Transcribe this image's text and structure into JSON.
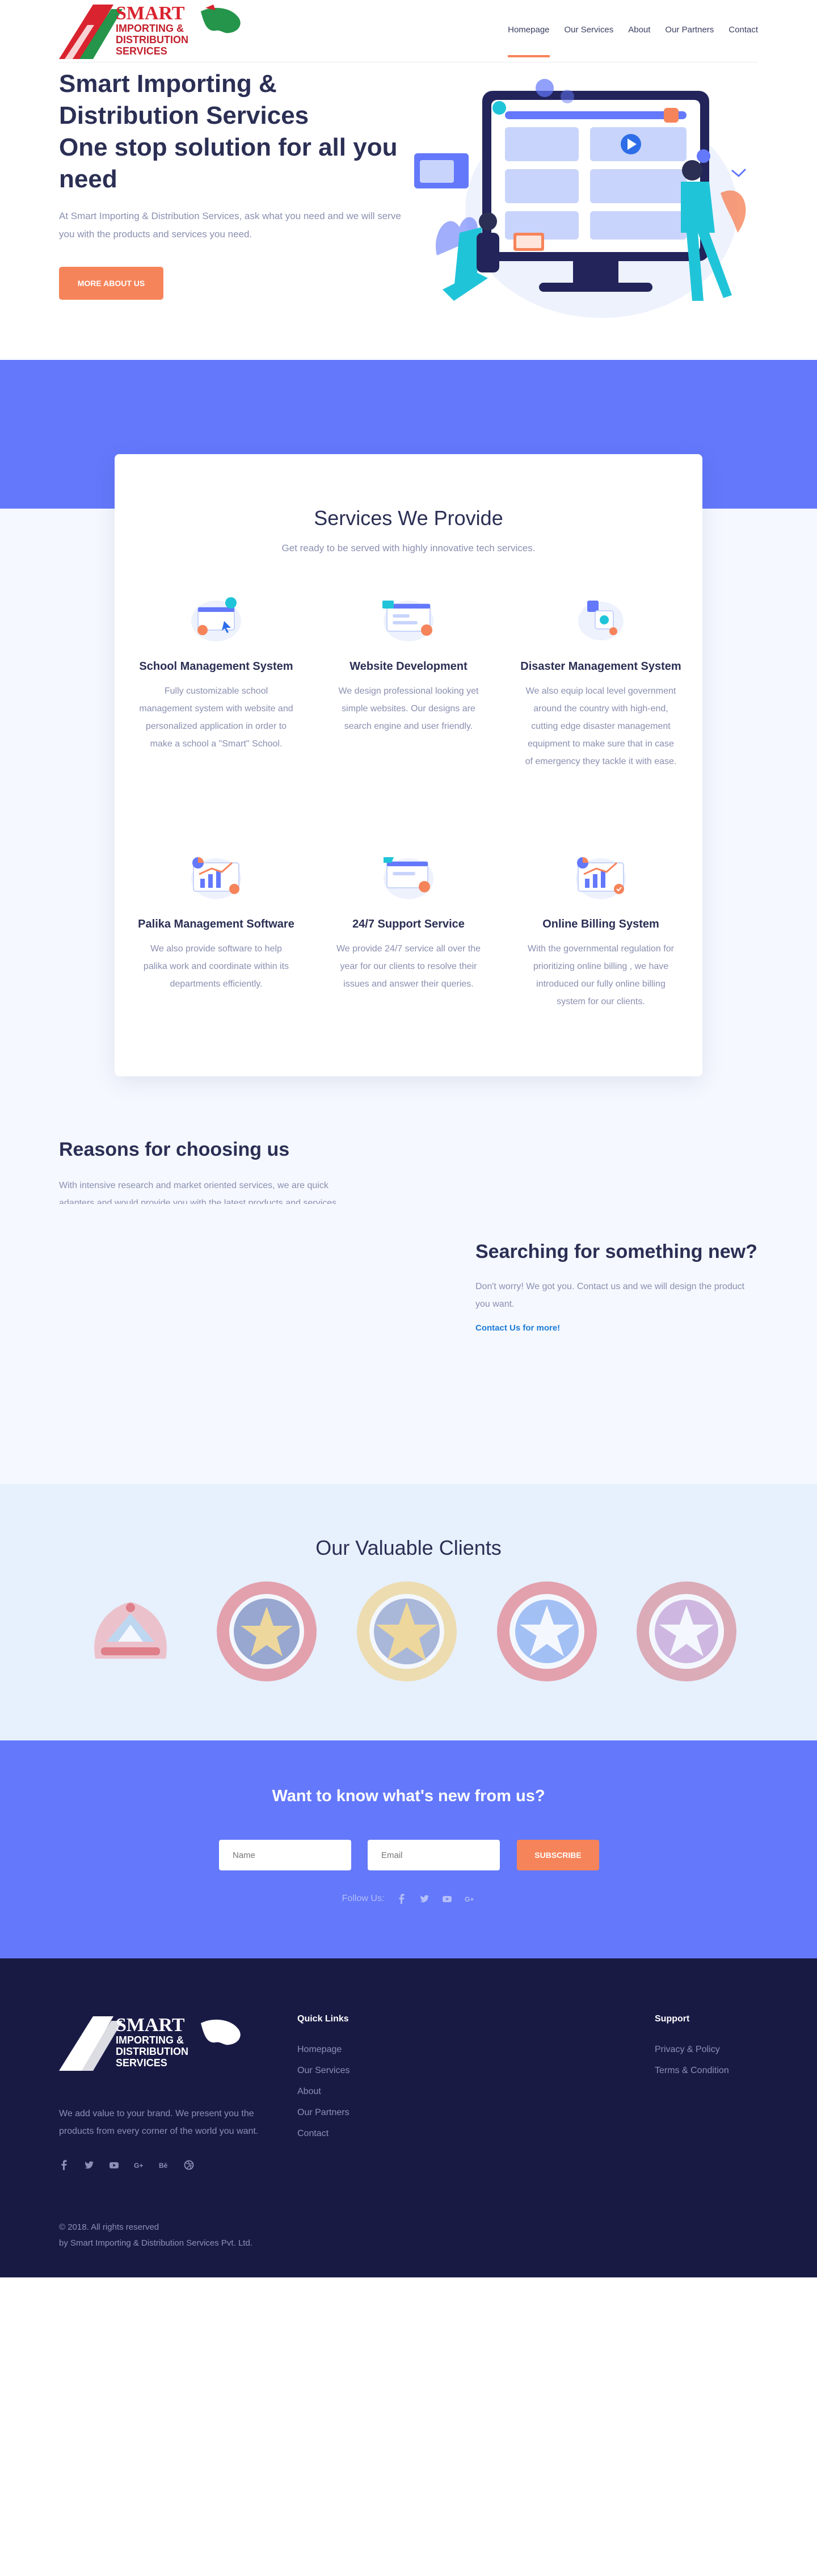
{
  "brand": {
    "logo_text": [
      "SMART",
      "IMPORTING &",
      "DISTRIBUTION",
      "SERVICES"
    ]
  },
  "nav": {
    "items": [
      "Homepage",
      "Our Services",
      "About",
      "Our Partners",
      "Contact"
    ],
    "active_index": 0
  },
  "hero": {
    "title_lines": [
      "Smart Importing &",
      "Distribution Services",
      "One stop solution for all you",
      "need"
    ],
    "lead": "At Smart Importing & Distribution Services, ask what you need and we will serve you with the products and services you need.",
    "button_label": "MORE ABOUT US"
  },
  "services": {
    "title": "Services We Provide",
    "subtitle": "Get ready to be served with highly innovative tech services.",
    "items": [
      {
        "title": "School Management System",
        "text": "Fully customizable school management system with website and personalized application in order to make a school a \"Smart\" School.",
        "icon": "school-management-icon"
      },
      {
        "title": "Website Development",
        "text": "We design professional looking yet simple websites. Our designs are search engine and user friendly.",
        "icon": "website-development-icon"
      },
      {
        "title": "Disaster Management System",
        "text": "We also equip local level government around the country with high-end, cutting edge disaster management equipment to make sure that in case of emergency they tackle it with ease.",
        "icon": "disaster-management-icon"
      },
      {
        "title": "Palika Management Software",
        "text": "We also provide software to help palika work and coordinate within its departments efficiently.",
        "icon": "palika-management-icon"
      },
      {
        "title": "24/7 Support Service",
        "text": "We provide 24/7 service all over the year for our clients to resolve their issues and answer their queries.",
        "icon": "support-service-icon"
      },
      {
        "title": "Online Billing System",
        "text": "With the governmental regulation for prioritizing online billing , we have introduced our fully online billing system for our clients.",
        "icon": "online-billing-icon"
      }
    ]
  },
  "reasons": {
    "title": "Reasons for choosing us",
    "text": "With intensive research and market oriented services, we are quick adapters and would provide you with the latest products and services required you to get your work done."
  },
  "search": {
    "title": "Searching for something new?",
    "text": "Don't worry! We got you. Contact us and we will design the product you want.",
    "link": "Contact Us for more!"
  },
  "clients": {
    "title": "Our Valuable Clients",
    "logos": [
      "nepal-government-emblem",
      "school-seal-1",
      "municipality-seal-1",
      "municipality-seal-2",
      "school-seal-2"
    ]
  },
  "newsletter": {
    "title": "Want to know what's new from us?",
    "name_placeholder": "Name",
    "email_placeholder": "Email",
    "button_label": "SUBSCRIBE",
    "follow_label": "Follow Us:",
    "social": [
      "facebook-icon",
      "twitter-icon",
      "youtube-icon",
      "google-plus-icon"
    ]
  },
  "footer": {
    "description": "We add value to your brand. We present you the products from every corner of the world you want.",
    "social": [
      "facebook-icon",
      "twitter-icon",
      "youtube-icon",
      "google-plus-icon",
      "behance-icon",
      "dribbble-icon"
    ],
    "quick_links_title": "Quick Links",
    "quick_links": [
      "Homepage",
      "Our Services",
      "About",
      "Our Partners",
      "Contact"
    ],
    "support_title": "Support",
    "support_links": [
      "Privacy & Policy",
      "Terms & Condition"
    ],
    "copyright_line1": "© 2018. All rights reserved",
    "copyright_line2": "by Smart Importing & Distribution Services Pvt. Ltd."
  },
  "colors": {
    "primary": "#6378fa",
    "accent": "#f6845a",
    "dark": "#191a44",
    "heading": "#2b2f54",
    "muted": "#8a8fb0",
    "link": "#1c7bd6"
  }
}
